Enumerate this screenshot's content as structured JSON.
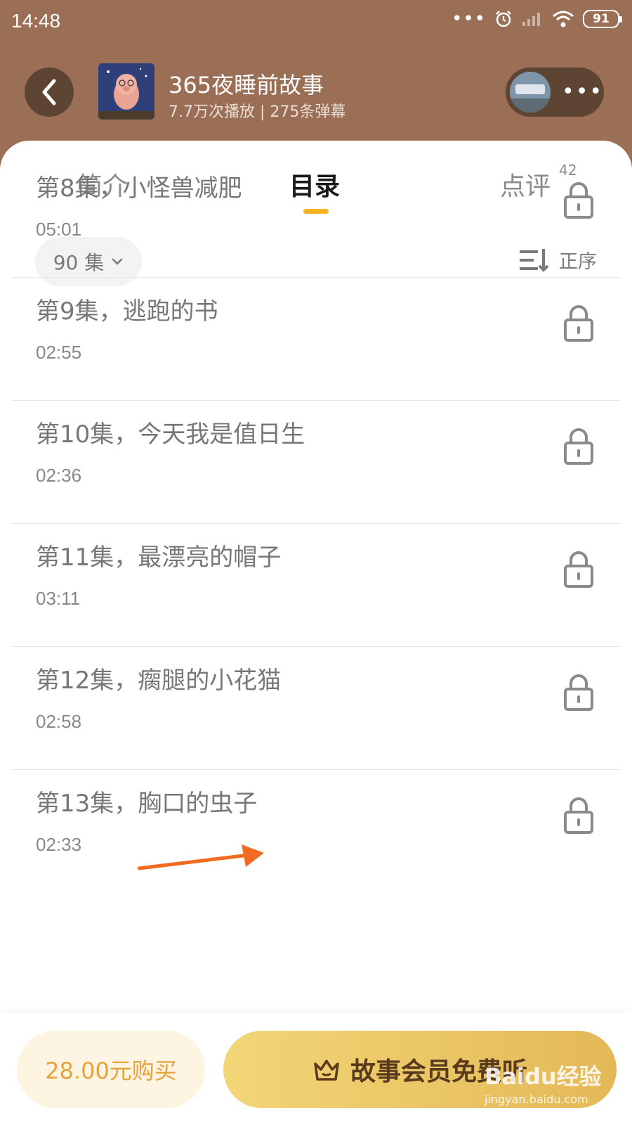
{
  "status_bar": {
    "time": "14:48",
    "battery": "91",
    "icons": [
      "alarm-icon",
      "signal-icon",
      "wifi-icon"
    ]
  },
  "header": {
    "title": "365夜睡前故事",
    "meta": "7.7万次播放 | 275条弹幕",
    "bg_color": "#9a6f55"
  },
  "tabs": [
    {
      "label": "简介"
    },
    {
      "label": "目录",
      "active": true
    },
    {
      "label": "点评",
      "badge": "42"
    }
  ],
  "filter": {
    "episodes_label": "90 集",
    "sort_label": "正序"
  },
  "episodes": [
    {
      "title": "第8集，小怪兽减肥",
      "duration": "05:01",
      "locked": true
    },
    {
      "title": "第9集，逃跑的书",
      "duration": "02:55",
      "locked": true
    },
    {
      "title": "第10集，今天我是值日生",
      "duration": "02:36",
      "locked": true
    },
    {
      "title": "第11集，最漂亮的帽子",
      "duration": "03:11",
      "locked": true
    },
    {
      "title": "第12集，瘸腿的小花猫",
      "duration": "02:58",
      "locked": true
    },
    {
      "title": "第13集，胸口的虫子",
      "duration": "02:33",
      "locked": true
    }
  ],
  "bottom_bar": {
    "buy_label": "28.00元购买",
    "vip_label": "故事会员免费听",
    "accent_color": "#f6b324"
  },
  "watermark": {
    "line1": "Baidu经验",
    "line2": "jingyan.baidu.com"
  }
}
